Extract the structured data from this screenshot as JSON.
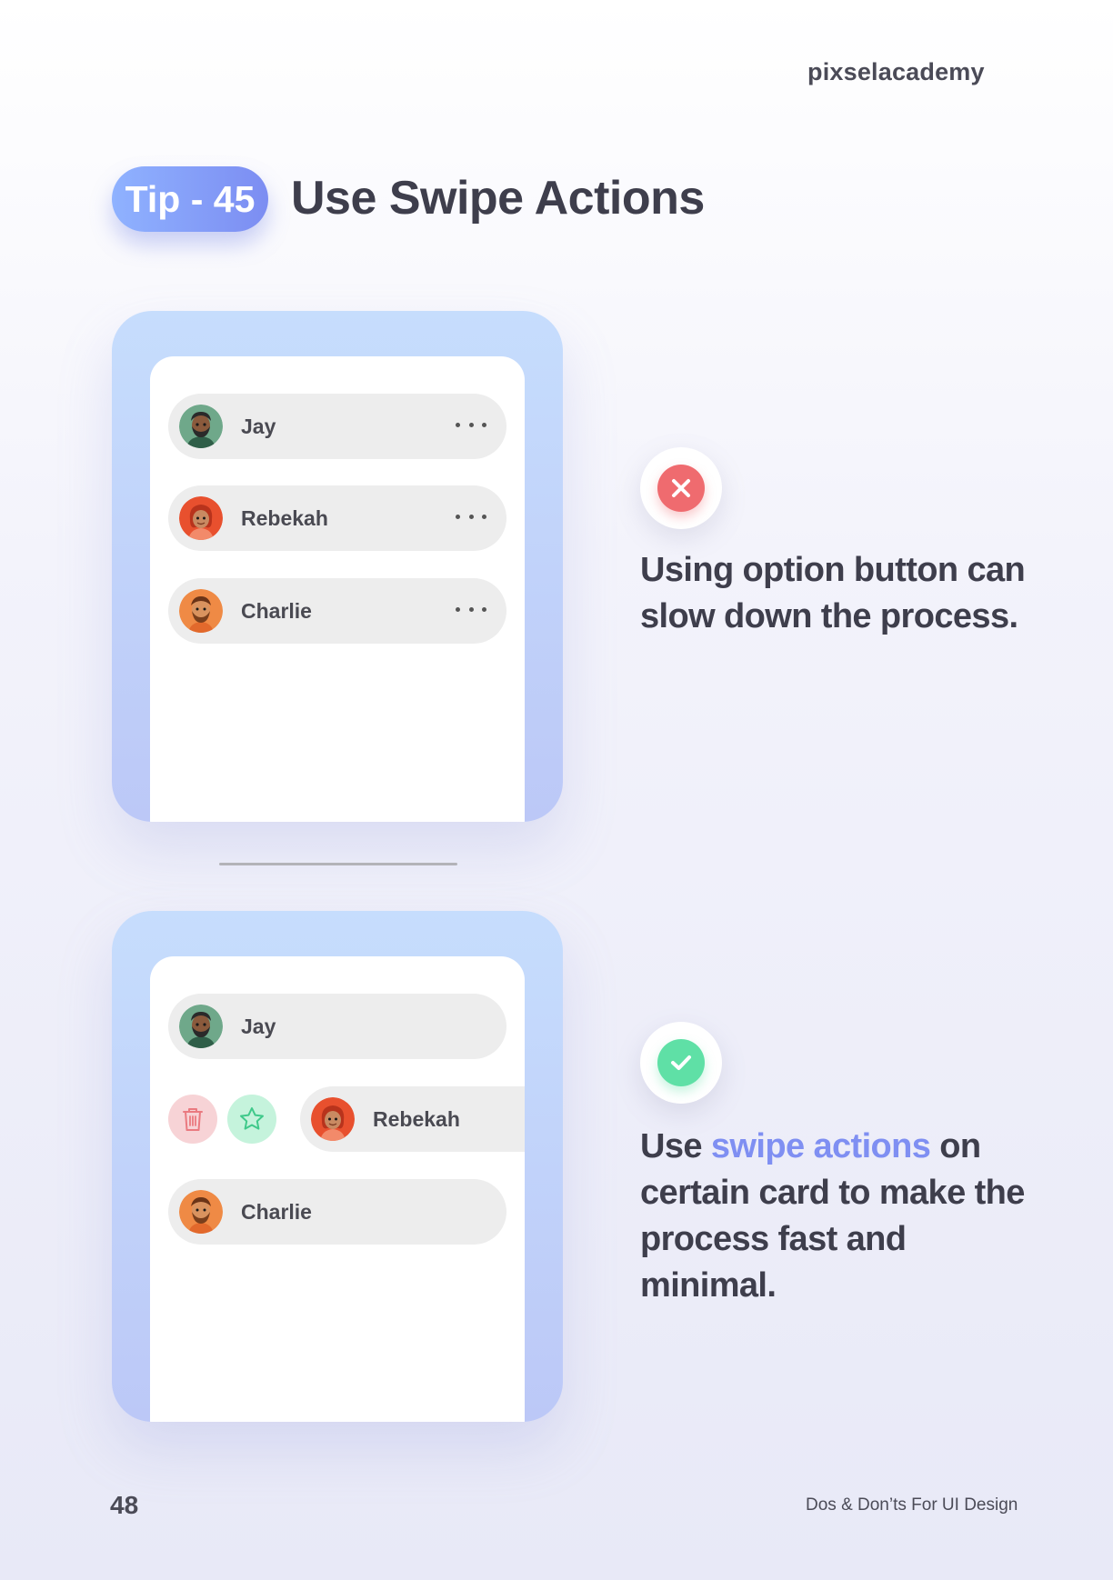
{
  "brand": "pixselacademy",
  "header": {
    "tip_label": "Tip - 45",
    "title": "Use Swipe Actions"
  },
  "bad_example": {
    "contacts": [
      {
        "name": "Jay"
      },
      {
        "name": "Rebekah"
      },
      {
        "name": "Charlie"
      }
    ],
    "caption": "Using option button can slow down the process.",
    "icon": "close-icon",
    "icon_color": "#ef6b6f"
  },
  "good_example": {
    "contacts": [
      {
        "name": "Jay"
      },
      {
        "name": "Rebekah"
      },
      {
        "name": "Charlie"
      }
    ],
    "swipe_actions": [
      "trash-icon",
      "star-icon"
    ],
    "caption_prefix": "Use",
    "caption_accent": "swipe actions",
    "caption_suffix": "on certain card to make the process fast and minimal.",
    "icon": "check-icon",
    "icon_color": "#5fe0a6",
    "accent_color": "#7f8ff2"
  },
  "footer": {
    "page_number": "48",
    "book_title": "Dos & Don’ts For UI Design"
  }
}
